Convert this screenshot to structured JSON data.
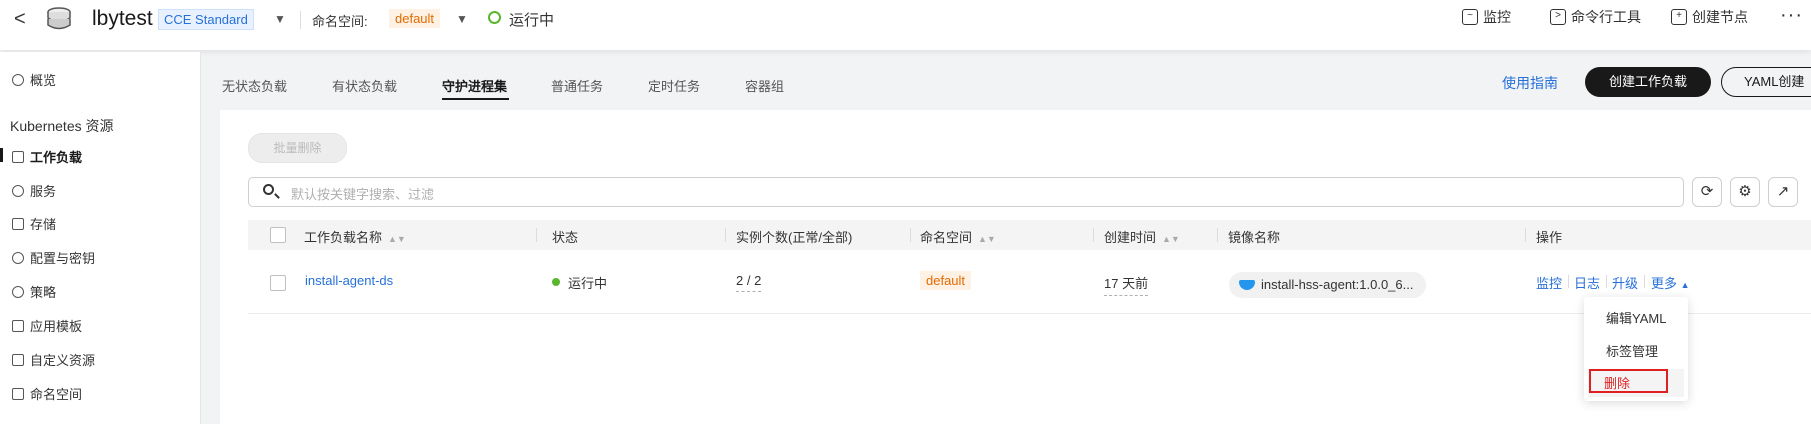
{
  "topbar": {
    "back_glyph": "<",
    "cluster_name": "lbytest",
    "cluster_edition": "CCE Standard",
    "namespace_label": "命名空间:",
    "namespace_value": "default",
    "cluster_status": "运行中",
    "monitor_label": "监控",
    "cli_label": "命令行工具",
    "create_node_label": "创建节点",
    "more_glyph": "···"
  },
  "sidebar": {
    "overview": "概览",
    "group_title": "Kubernetes 资源",
    "items": [
      {
        "label": "工作负载",
        "icon": "workload-icon",
        "active": true
      },
      {
        "label": "服务",
        "icon": "globe-icon"
      },
      {
        "label": "存储",
        "icon": "storage-icon"
      },
      {
        "label": "配置与密钥",
        "icon": "key-icon"
      },
      {
        "label": "策略",
        "icon": "lightbulb-icon"
      },
      {
        "label": "应用模板",
        "icon": "template-icon"
      },
      {
        "label": "自定义资源",
        "icon": "layers-icon"
      },
      {
        "label": "命名空间",
        "icon": "cube-icon"
      }
    ]
  },
  "tabs": [
    "无状态负载",
    "有状态负载",
    "守护进程集",
    "普通任务",
    "定时任务",
    "容器组"
  ],
  "active_tab": "守护进程集",
  "actions": {
    "guide": "使用指南",
    "create_workload": "创建工作负载",
    "yaml_create": "YAML创建"
  },
  "toolbar": {
    "batch_delete": "批量删除",
    "search_placeholder": "默认按关键字搜索、过滤"
  },
  "table": {
    "columns": [
      "工作负载名称",
      "状态",
      "实例个数(正常/全部)",
      "命名空间",
      "创建时间",
      "镜像名称",
      "操作"
    ],
    "rows": [
      {
        "name": "install-agent-ds",
        "status": "运行中",
        "instances": "2 / 2",
        "namespace": "default",
        "created": "17 天前",
        "image": "install-hss-agent:1.0.0_6...",
        "ops": [
          "监控",
          "日志",
          "升级",
          "更多"
        ]
      }
    ]
  },
  "more_menu": [
    "编辑YAML",
    "标签管理",
    "删除"
  ],
  "colors": {
    "accent": "#2770d9",
    "success": "#5ab62d",
    "warning_text": "#e26b00",
    "danger": "#e02020"
  }
}
